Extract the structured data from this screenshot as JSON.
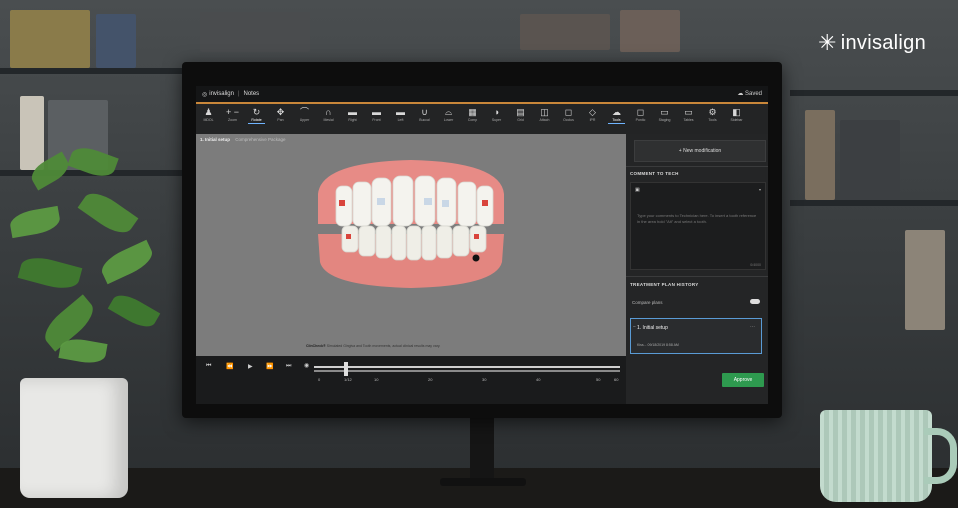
{
  "overlay": {
    "brand": "invisalign"
  },
  "app": {
    "brand": "invisalign",
    "menu": "Notes",
    "save": "Saved"
  },
  "toolbar": {
    "tools": [
      {
        "icon": "♟",
        "label": "MDOL"
      },
      {
        "icon": "+ −",
        "label": "Zoom"
      },
      {
        "icon": "↻",
        "label": "Rotate",
        "active": true
      },
      {
        "icon": "✥",
        "label": "Pan"
      },
      {
        "icon": "⌒",
        "label": "Upper"
      },
      {
        "icon": "∩",
        "label": "Mesial"
      },
      {
        "icon": "▬",
        "label": "Right"
      },
      {
        "icon": "▬",
        "label": "Front"
      },
      {
        "icon": "▬",
        "label": "Left"
      },
      {
        "icon": "∪",
        "label": "Buccal"
      },
      {
        "icon": "⌓",
        "label": "Lower"
      },
      {
        "icon": "▦",
        "label": "Comp"
      },
      {
        "icon": "◑",
        "label": "Super"
      },
      {
        "icon": "▤",
        "label": "Grid"
      },
      {
        "icon": "◫",
        "label": "Attach"
      },
      {
        "icon": "◻",
        "label": "Occlus"
      },
      {
        "icon": "◇",
        "label": "IPR"
      },
      {
        "icon": "☁",
        "label": "Tools",
        "active": true
      },
      {
        "icon": "◻",
        "label": "Pontic"
      },
      {
        "icon": "▭",
        "label": "Staging"
      },
      {
        "icon": "▭",
        "label": "Tables"
      },
      {
        "icon": "⚙",
        "label": "Tools"
      },
      {
        "icon": "◧",
        "label": "Sidebar"
      }
    ]
  },
  "viewport": {
    "title": "1. Initial setup",
    "subtitle": "Comprehensive Package",
    "note_bold": "ClinCheck®",
    "note": "Simulated Gingiva and Tooth movements, actual clinical results may vary."
  },
  "timeline": {
    "ticks": [
      "0",
      "1/12",
      "10",
      "20",
      "30",
      "40",
      "50",
      "60"
    ]
  },
  "panel": {
    "new_modification": "+ New modification",
    "comment_heading": "COMMENT TO TECH",
    "comment_placeholder": "Type your comments to Technician here. To insert a tooth reference in the area hold \"Alt\" and select a tooth.",
    "char_count": "0/4000",
    "history_heading": "TREATMENT PLAN HISTORY",
    "compare_plans": "Compare plans",
    "plan_item": "1. Initial setup",
    "plan_sub": "Kiss... 09/18/2019 8:58 AM",
    "approve": "Approve"
  },
  "colors": {
    "accent": "#c9873a",
    "approve": "#2e9a4f",
    "selection": "#5a9bd5"
  }
}
